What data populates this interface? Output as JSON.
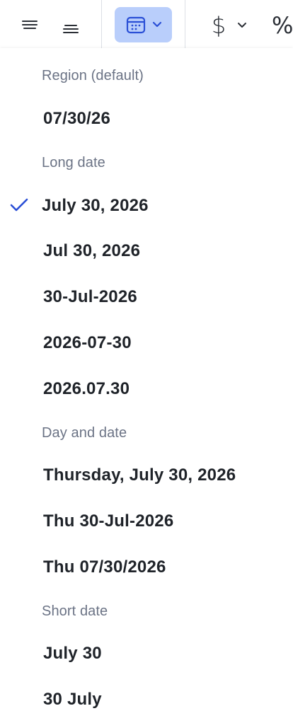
{
  "colors": {
    "accent": "#2a4fd6",
    "active_bg": "#b9cefb",
    "header_text": "#6b7385",
    "item_text": "#1f2329",
    "separator": "#dcdfe5"
  },
  "toolbar": {
    "align_icon_1": "align-center-icon",
    "align_icon_2": "align-bottom-icon",
    "date_format_icon": "calendar-icon",
    "date_format_chevron": "chevron-down-icon",
    "currency_icon": "dollar-icon",
    "currency_chevron": "chevron-down-icon",
    "percent_icon": "percent-icon",
    "currency_symbol": "$",
    "percent_symbol": "%"
  },
  "menu": {
    "sections": [
      {
        "header": "Region (default)",
        "items": [
          {
            "label": "07/30/26",
            "selected": false
          }
        ]
      },
      {
        "header": "Long date",
        "items": [
          {
            "label": "July 30, 2026",
            "selected": true
          },
          {
            "label": "Jul 30, 2026",
            "selected": false
          },
          {
            "label": "30-Jul-2026",
            "selected": false
          },
          {
            "label": "2026-07-30",
            "selected": false
          },
          {
            "label": "2026.07.30",
            "selected": false
          }
        ]
      },
      {
        "header": "Day and date",
        "items": [
          {
            "label": "Thursday, July 30, 2026",
            "selected": false
          },
          {
            "label": "Thu 30-Jul-2026",
            "selected": false
          },
          {
            "label": "Thu 07/30/2026",
            "selected": false
          }
        ]
      },
      {
        "header": "Short date",
        "items": [
          {
            "label": "July 30",
            "selected": false
          },
          {
            "label": "30 July",
            "selected": false
          }
        ]
      }
    ]
  }
}
